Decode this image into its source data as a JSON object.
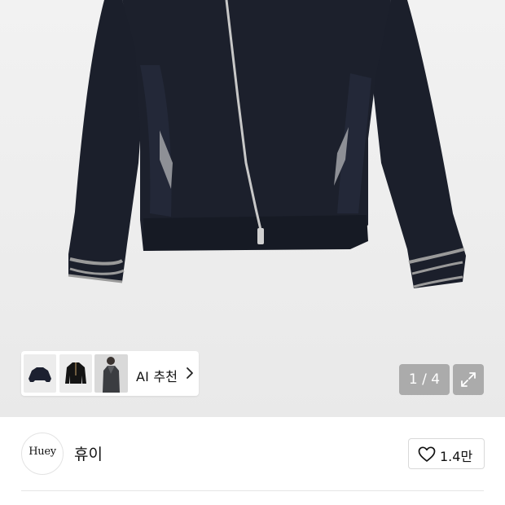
{
  "gallery": {
    "ai_recommend_label": "AI 추천",
    "counter": "1 / 4",
    "thumbnails": [
      "jacket-front-thumbnail",
      "jacket-black-thumbnail",
      "model-wearing-thumbnail"
    ]
  },
  "brand": {
    "logo_text": "Huey",
    "name": "휴이"
  },
  "likes": {
    "count": "1.4만"
  },
  "icons": {
    "ai_chevron": "chevron-right-icon",
    "expand": "expand-icon",
    "like": "heart-icon"
  }
}
